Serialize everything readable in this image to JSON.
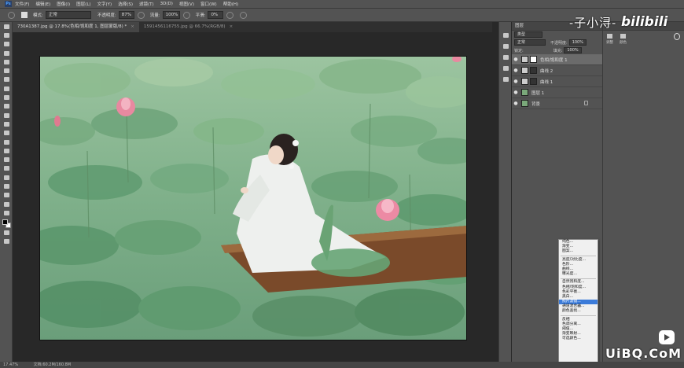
{
  "menubar": {
    "items": [
      "文件(F)",
      "编辑(E)",
      "图像(I)",
      "图层(L)",
      "文字(Y)",
      "选择(S)",
      "滤镜(T)",
      "3D(D)",
      "视图(V)",
      "窗口(W)",
      "帮助(H)"
    ],
    "logo": "Ps"
  },
  "options": {
    "mode_label": "模式:",
    "mode_value": "正常",
    "opacity_label": "不透明度:",
    "opacity_value": "87%",
    "flow_label": "流量:",
    "flow_value": "100%",
    "smooth_label": "平滑:",
    "smooth_value": "0%"
  },
  "tabs": [
    {
      "label": "730A1387.jpg @ 17.8%(色相/饱和度 1, 图层蒙版/8) *",
      "close": "×"
    },
    {
      "label": "1591456116755.jpg @ 66.7%(RGB/8)",
      "close": "×"
    }
  ],
  "layers_panel": {
    "tab": "图层",
    "kind": "类型",
    "blend": "正常",
    "opacity_label": "不透明度:",
    "opacity_value": "100%",
    "lock_label": "锁定:",
    "fill_label": "填充:",
    "fill_value": "100%",
    "layers": [
      {
        "name": "色相/饱和度 1",
        "selected": true,
        "type": "adjustment"
      },
      {
        "name": "曲线 2",
        "selected": false,
        "type": "adjustment"
      },
      {
        "name": "曲线 1",
        "selected": false,
        "type": "adjustment"
      },
      {
        "name": "图层 1",
        "selected": false,
        "type": "image"
      },
      {
        "name": "背景",
        "selected": false,
        "type": "image",
        "locked": true
      }
    ]
  },
  "right_panel": {
    "col1": "调整",
    "col2": "颜色"
  },
  "context_menu": {
    "items": [
      "纯色...",
      "渐变...",
      "图案...",
      "-",
      "亮度/对比度...",
      "色阶...",
      "曲线...",
      "曝光度...",
      "-",
      "自然饱和度...",
      "色相/饱和度...",
      "色彩平衡...",
      "黑白...",
      "照片滤镜...",
      "通道混合器...",
      "颜色查找...",
      "-",
      "反相",
      "色调分离...",
      "阈值...",
      "渐变映射...",
      "可选颜色..."
    ],
    "highlighted": "照片滤镜..."
  },
  "status": {
    "zoom": "17.47%",
    "doc": "文档:60.2M/160.8M"
  },
  "watermark": {
    "author": "-子小浔-",
    "site": "bilibili",
    "bottom": "UiBQ.CoM"
  }
}
